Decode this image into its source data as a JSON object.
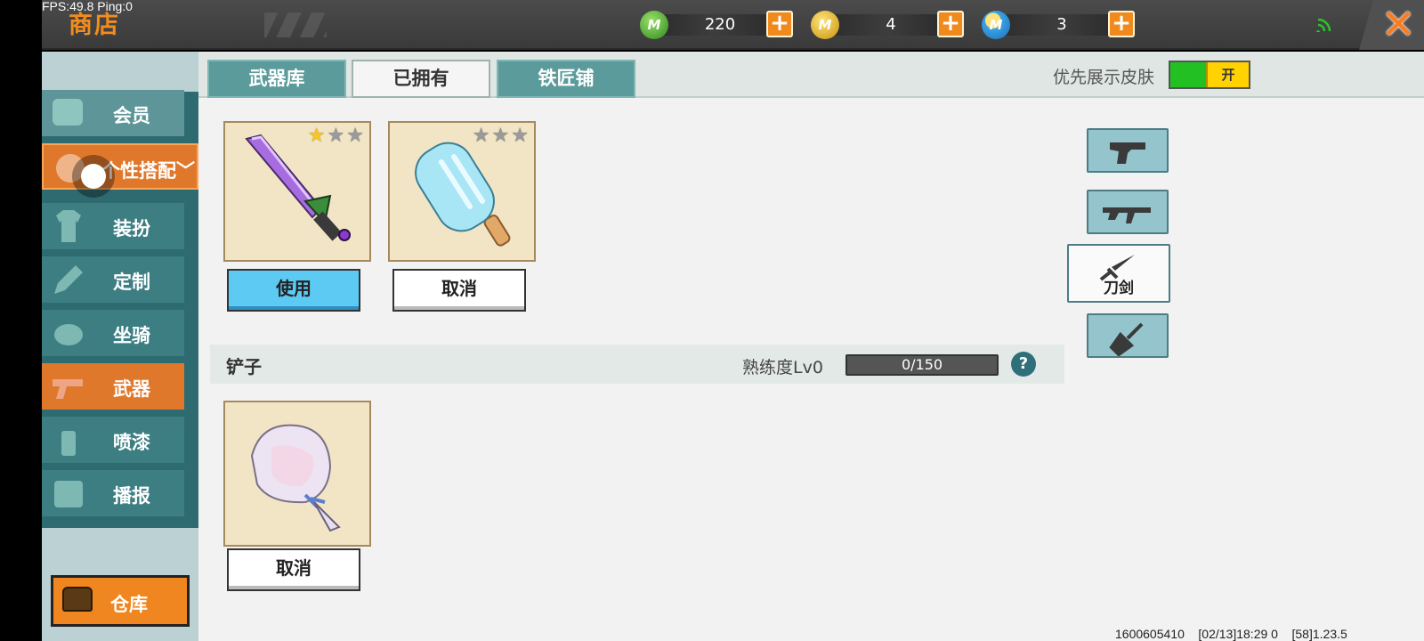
{
  "debug": {
    "fps_text": "FPS:49.8  Ping:0"
  },
  "header": {
    "title": "商店",
    "currencies": [
      {
        "icon": "green-gem-coin-icon",
        "value": "220",
        "color": "#3fae2f",
        "letter": "M"
      },
      {
        "icon": "gold-coin-icon",
        "value": "4",
        "color": "#e6b61f",
        "letter": "M"
      },
      {
        "icon": "blue-coin-icon",
        "value": "3",
        "color": "#2f97dd",
        "letter": "M"
      }
    ]
  },
  "sidebar": {
    "items": [
      {
        "label": "会员"
      },
      {
        "label": "个性搭配"
      },
      {
        "label": "装扮"
      },
      {
        "label": "定制"
      },
      {
        "label": "坐骑"
      },
      {
        "label": "武器"
      },
      {
        "label": "喷漆"
      },
      {
        "label": "播报"
      }
    ],
    "warehouse_label": "仓库"
  },
  "tabs": [
    {
      "label": "武器库"
    },
    {
      "label": "已拥有"
    },
    {
      "label": "铁匠铺"
    }
  ],
  "skin_toggle": {
    "label": "优先展示皮肤",
    "state": "开"
  },
  "items_top": [
    {
      "name": "purple-sword",
      "stars_on": 1,
      "stars_total": 3,
      "button": "使用"
    },
    {
      "name": "ice-popsicle",
      "stars_on": 0,
      "stars_total": 3,
      "button": "取消"
    }
  ],
  "section": {
    "title": "铲子",
    "proficiency_label": "熟练度Lv0",
    "proficiency_value": "0/150",
    "proficiency_progress": 0,
    "help": "?"
  },
  "items_bottom": [
    {
      "name": "seashell-shovel",
      "button": "取消"
    }
  ],
  "filters": [
    {
      "icon": "revolver-icon",
      "label": ""
    },
    {
      "icon": "rifle-icon",
      "label": ""
    },
    {
      "icon": "sword-icon",
      "label": "刀剑"
    },
    {
      "icon": "shovel-icon",
      "label": ""
    }
  ],
  "footer": {
    "info": "1600605410    [02/13]18:29 0    [58]1.23.5"
  }
}
